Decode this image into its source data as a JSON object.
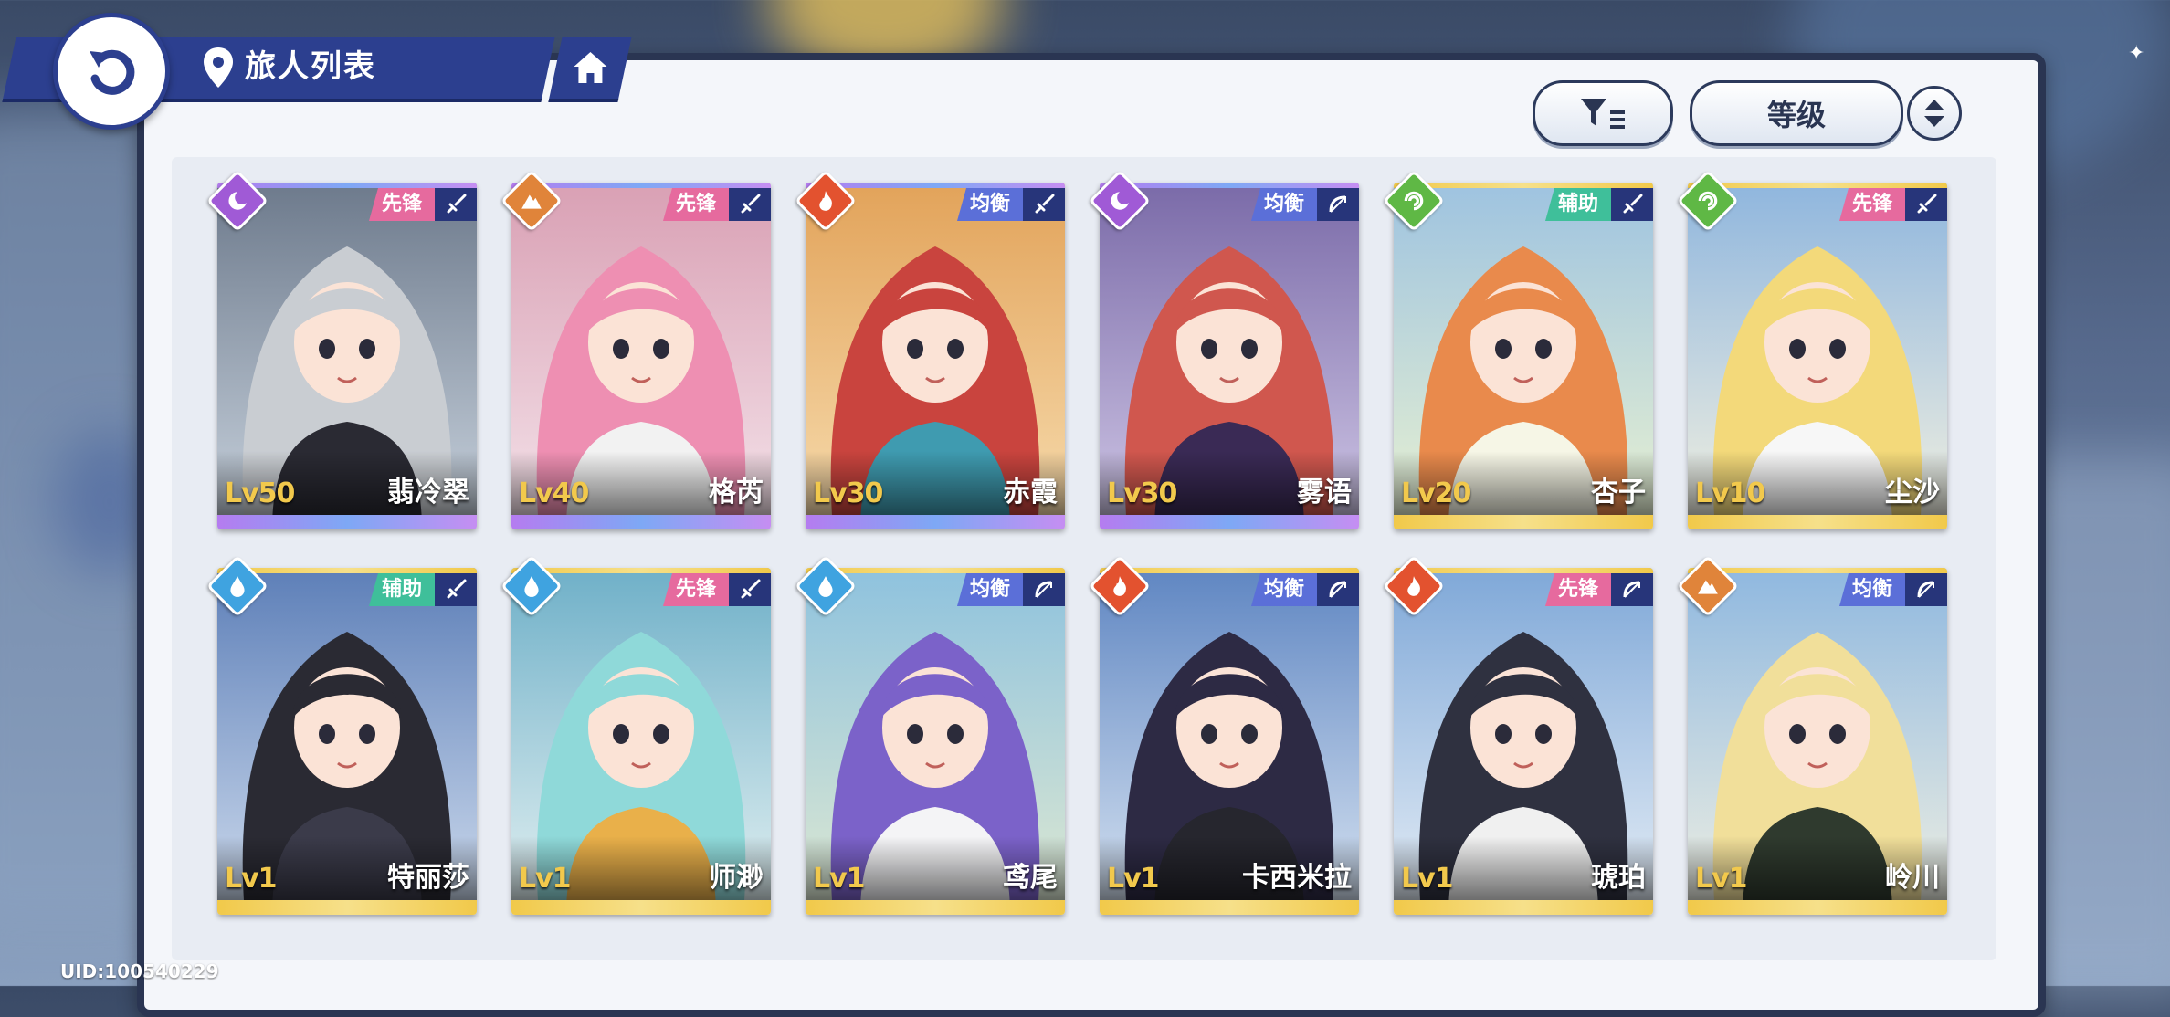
{
  "header": {
    "title": "旅人列表",
    "back_icon": "back-arrow-icon",
    "location_icon": "map-pin-icon",
    "home_icon": "home-icon"
  },
  "toolbar": {
    "filter_icon": "filter-icon",
    "sort_label": "等级",
    "order_icon": "sort-order-icon"
  },
  "colors": {
    "panel_border": "#2a3552",
    "header_blue": "#2c3f8f",
    "level_gold": "#f2c94c",
    "role_vanguard": "#e66a9e",
    "role_balanced": "#5b6fd8",
    "role_support": "#3fbf9a",
    "element_dark": "#a05ad6",
    "element_earth": "#e0843a",
    "element_fire": "#e3522f",
    "element_wind": "#5fb845",
    "element_water": "#3fa3e0"
  },
  "characters": [
    {
      "name": "翡冷翠",
      "level": "Lv50",
      "role": "先锋",
      "element": "dark",
      "weapon": "sword",
      "rarity": "ssr"
    },
    {
      "name": "格芮",
      "level": "Lv40",
      "role": "先锋",
      "element": "earth",
      "weapon": "sword",
      "rarity": "ssr"
    },
    {
      "name": "赤霞",
      "level": "Lv30",
      "role": "均衡",
      "element": "fire",
      "weapon": "sword",
      "rarity": "ssr"
    },
    {
      "name": "雾语",
      "level": "Lv30",
      "role": "均衡",
      "element": "dark",
      "weapon": "bow",
      "rarity": "ssr"
    },
    {
      "name": "杏子",
      "level": "Lv20",
      "role": "辅助",
      "element": "wind",
      "weapon": "sword",
      "rarity": "sr"
    },
    {
      "name": "尘沙",
      "level": "Lv10",
      "role": "先锋",
      "element": "wind",
      "weapon": "sword",
      "rarity": "sr"
    },
    {
      "name": "特丽莎",
      "level": "Lv1",
      "role": "辅助",
      "element": "water",
      "weapon": "sword",
      "rarity": "sr"
    },
    {
      "name": "师渺",
      "level": "Lv1",
      "role": "先锋",
      "element": "water",
      "weapon": "sword",
      "rarity": "sr"
    },
    {
      "name": "鸢尾",
      "level": "Lv1",
      "role": "均衡",
      "element": "water",
      "weapon": "bow",
      "rarity": "sr"
    },
    {
      "name": "卡西米拉",
      "level": "Lv1",
      "role": "均衡",
      "element": "fire",
      "weapon": "bow",
      "rarity": "sr"
    },
    {
      "name": "琥珀",
      "level": "Lv1",
      "role": "先锋",
      "element": "fire",
      "weapon": "bow",
      "rarity": "sr"
    },
    {
      "name": "岭川",
      "level": "Lv1",
      "role": "均衡",
      "element": "earth",
      "weapon": "bow",
      "rarity": "sr"
    }
  ],
  "footer": {
    "uid": "UID:100540229"
  }
}
